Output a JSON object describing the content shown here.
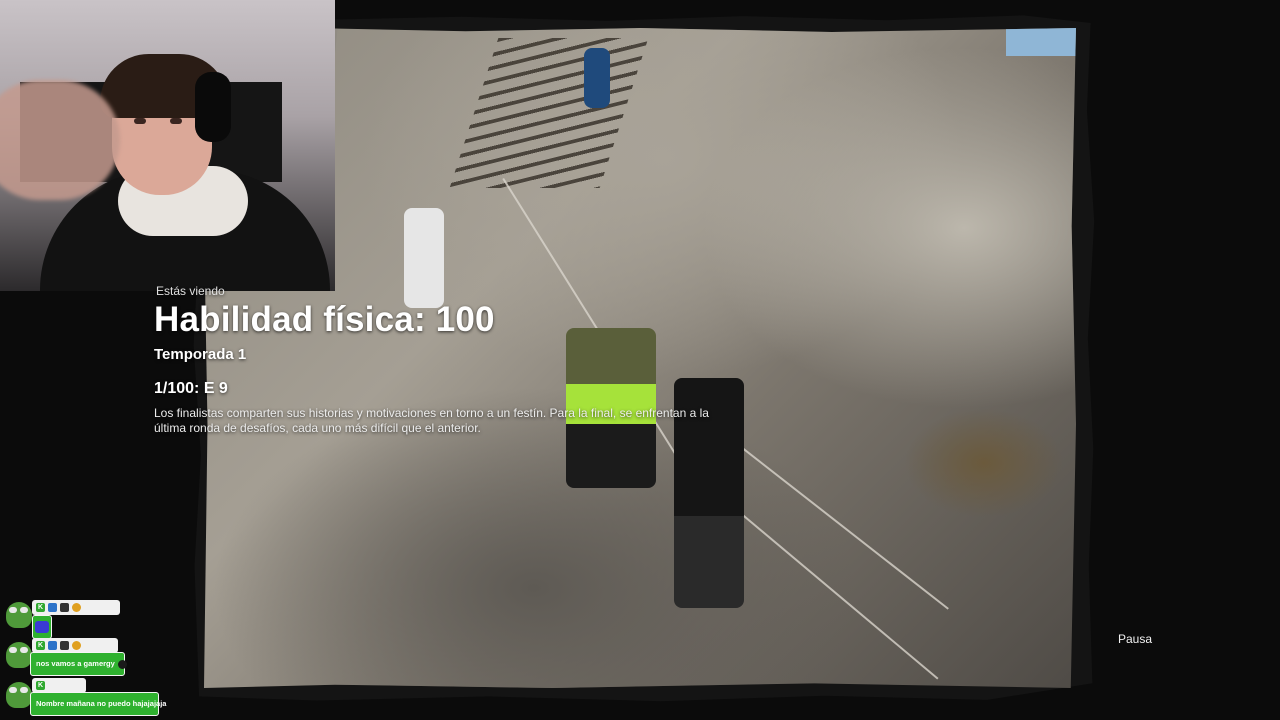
{
  "overlay": {
    "watching_label": "Estás viendo",
    "show_title": "Habilidad física: 100",
    "season": "Temporada 1",
    "episode": "1/100: E 9",
    "description": "Los finalistas comparten sus historias y motivaciones en torno a un festín. Para la final, se enfrentan a la última ronda de desafíos, cada uno más difícil que el anterior."
  },
  "player": {
    "pause_label": "Pausa",
    "is_paused": true
  },
  "chat": {
    "messages": [
      {
        "username": "",
        "text": "",
        "emote": "blue-emote-icon",
        "badges": [
          "K",
          "A",
          "cat",
          "gold"
        ]
      },
      {
        "username": "",
        "text": "nos vamos a gamergy",
        "emote": "dark-emote-icon",
        "badges": [
          "K",
          "A",
          "cat",
          "gold"
        ]
      },
      {
        "username": "",
        "text": "Nombre mañana no puedo hajajajaja",
        "emote": "",
        "badges": [
          "K"
        ]
      }
    ],
    "accent_color": "#2fb12f"
  }
}
